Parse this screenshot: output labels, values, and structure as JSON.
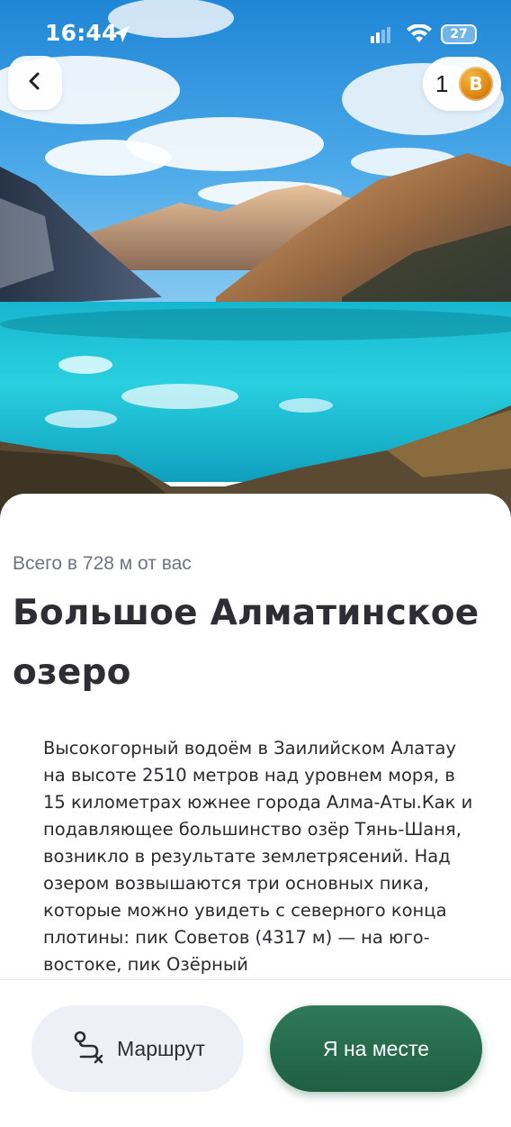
{
  "status_bar": {
    "time": "16:44",
    "battery_level": "27",
    "icons": [
      "location-arrow-icon",
      "signal-icon",
      "wifi-icon",
      "battery-icon"
    ]
  },
  "header": {
    "back_icon": "chevron-left-icon",
    "coins": {
      "count": "1",
      "icon": "bitcoin-coin-icon",
      "symbol": "B"
    }
  },
  "place": {
    "distance": "Всего в 728 м от вас",
    "title": "Большое Алматинское озеро",
    "description": "Высокогорный водоём в Заилийском Алатау на высоте 2510 метров над уровнем моря, в 15 километрах южнее города Алма-Аты.Как и подавляющее большинство озёр Тянь-Шаня, возникло в результате землетрясений. Над озером возвышаются три основных пика, которые можно увидеть с северного конца плотины: пик Советов (4317 м) — на юго-востоке, пик Озёрный"
  },
  "actions": {
    "route_label": "Маршрут",
    "route_icon": "route-remove-icon",
    "arrived_label": "Я на месте"
  },
  "colors": {
    "accent_green": "#2f7a58",
    "route_button_bg": "#eef0f7",
    "coin_orange": "#e08a12",
    "title_text": "#2d2d33",
    "secondary_text": "#6e7480"
  }
}
